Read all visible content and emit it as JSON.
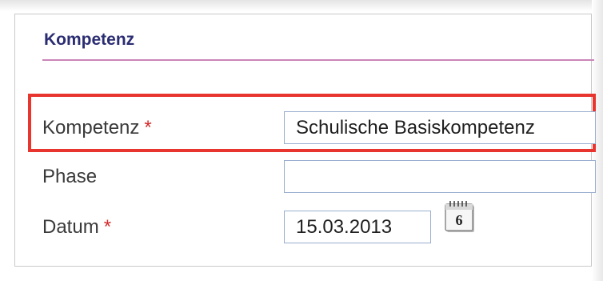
{
  "section": {
    "title": "Kompetenz"
  },
  "fields": {
    "kompetenz": {
      "label": "Kompetenz",
      "required_mark": "*",
      "value": "Schulische Basiskompetenz"
    },
    "phase": {
      "label": "Phase",
      "value": ""
    },
    "datum": {
      "label": "Datum",
      "required_mark": "*",
      "value": "15.03.2013"
    }
  },
  "calendar": {
    "icon": "calendar-icon",
    "day": "6"
  },
  "colors": {
    "title": "#2b2d72",
    "title_rule": "#c985b8",
    "highlight": "#e8362f",
    "required": "#d42a2a",
    "field_border": "#9aaed0"
  }
}
